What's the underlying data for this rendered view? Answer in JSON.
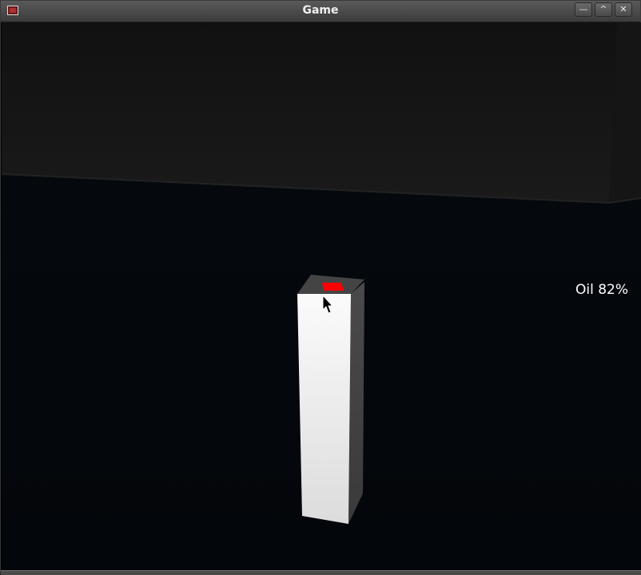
{
  "window": {
    "title": "Game",
    "buttons": {
      "minimize": "—",
      "maximize": "^",
      "close": "✕"
    }
  },
  "hud": {
    "oil_text": "Oil 82%"
  },
  "scene": {
    "pillar_top_marker_color": "#ff0000",
    "pillar_color": "#f2f2f2"
  }
}
